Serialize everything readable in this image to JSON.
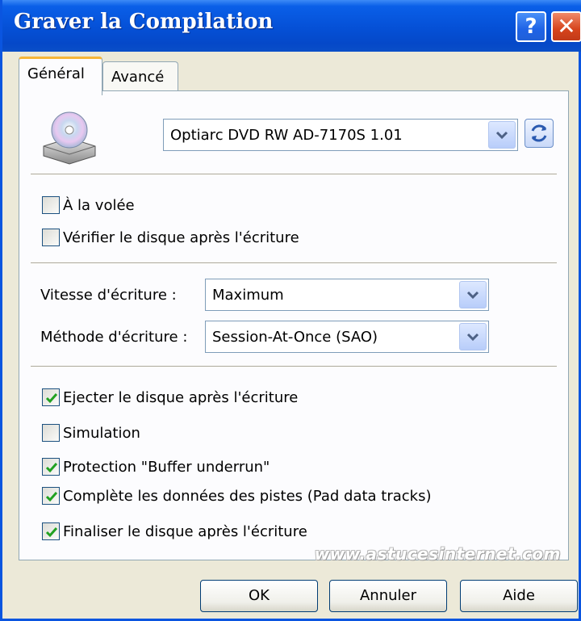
{
  "window": {
    "title": "Graver la Compilation",
    "help_label": "?",
    "close_label": "✕"
  },
  "tabs": [
    {
      "label": "Général",
      "active": true
    },
    {
      "label": "Avancé",
      "active": false
    }
  ],
  "drive": {
    "selected": "Optiarc DVD RW AD-7170S 1.01",
    "icon": "cd-drive-icon",
    "refresh_icon": "refresh-icon"
  },
  "options_top": [
    {
      "label": "À la volée",
      "checked": false
    },
    {
      "label": "Vérifier le disque après l'écriture",
      "checked": false
    }
  ],
  "speed": {
    "label": "Vitesse d'écriture :",
    "value": "Maximum"
  },
  "method": {
    "label": "Méthode d'écriture :",
    "value": "Session-At-Once (SAO)"
  },
  "options_bottom": [
    {
      "label": "Ejecter le disque après l'écriture",
      "checked": true
    },
    {
      "label": "Simulation",
      "checked": false
    },
    {
      "label": "Protection \"Buffer underrun\"",
      "checked": true
    },
    {
      "label": "Complète les données des pistes (Pad data tracks)",
      "checked": true
    },
    {
      "label": "Finaliser le disque après l'écriture",
      "checked": true
    }
  ],
  "watermark": "www.astucesinternet.com",
  "buttons": {
    "ok": "OK",
    "cancel": "Annuler",
    "help": "Aide"
  }
}
